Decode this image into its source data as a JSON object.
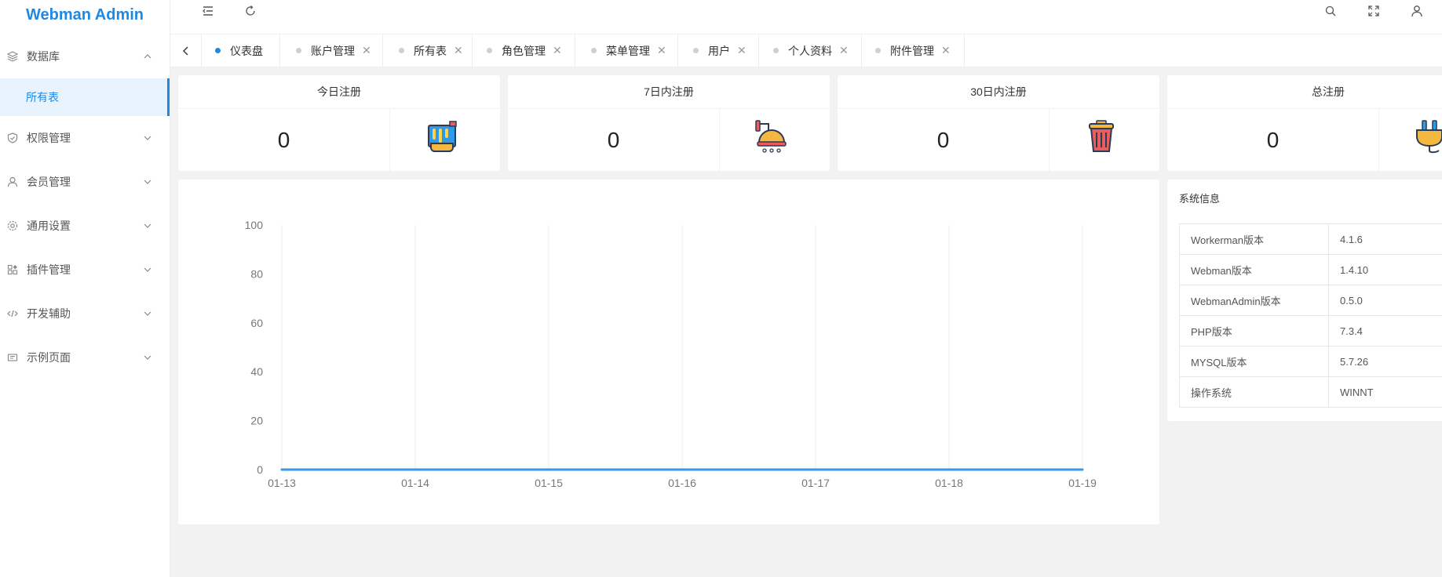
{
  "app": {
    "title": "Webman Admin"
  },
  "sidebar": {
    "items": [
      {
        "label": "数据库",
        "icon": "layers-icon",
        "expanded": true
      },
      {
        "label": "权限管理",
        "icon": "shield-icon"
      },
      {
        "label": "会员管理",
        "icon": "user-icon"
      },
      {
        "label": "通用设置",
        "icon": "gear-icon"
      },
      {
        "label": "插件管理",
        "icon": "apps-icon"
      },
      {
        "label": "开发辅助",
        "icon": "code-icon"
      },
      {
        "label": "示例页面",
        "icon": "page-icon"
      }
    ],
    "sub_item": "所有表"
  },
  "tabs": [
    {
      "label": "仪表盘",
      "active": true,
      "closable": false
    },
    {
      "label": "账户管理",
      "closable": true
    },
    {
      "label": "所有表",
      "closable": true
    },
    {
      "label": "角色管理",
      "closable": true
    },
    {
      "label": "菜单管理",
      "closable": true
    },
    {
      "label": "用户",
      "closable": true
    },
    {
      "label": "个人资料",
      "closable": true
    },
    {
      "label": "附件管理",
      "closable": true
    }
  ],
  "tab_close_glyph": "✕",
  "stats": [
    {
      "title": "今日注册",
      "value": "0",
      "icon": "paint-bucket-icon"
    },
    {
      "title": "7日内注册",
      "value": "0",
      "icon": "shower-icon"
    },
    {
      "title": "30日内注册",
      "value": "0",
      "icon": "trash-can-icon"
    },
    {
      "title": "总注册",
      "value": "0",
      "icon": "plug-icon"
    }
  ],
  "chart_data": {
    "type": "line",
    "categories": [
      "01-13",
      "01-14",
      "01-15",
      "01-16",
      "01-17",
      "01-18",
      "01-19"
    ],
    "values": [
      0,
      0,
      0,
      0,
      0,
      0,
      0
    ],
    "yticks": [
      0,
      20,
      40,
      60,
      80,
      100
    ],
    "ylim": [
      0,
      100
    ],
    "grid": true,
    "line_color": "#3a96e8"
  },
  "system": {
    "title": "系统信息",
    "rows": [
      {
        "key": "Workerman版本",
        "value": "4.1.6"
      },
      {
        "key": "Webman版本",
        "value": "1.4.10"
      },
      {
        "key": "WebmanAdmin版本",
        "value": "0.5.0"
      },
      {
        "key": "PHP版本",
        "value": "7.3.4"
      },
      {
        "key": "MYSQL版本",
        "value": "5.7.26"
      },
      {
        "key": "操作系统",
        "value": "WINNT"
      }
    ]
  },
  "colors": {
    "accent": "#1e88e5"
  }
}
